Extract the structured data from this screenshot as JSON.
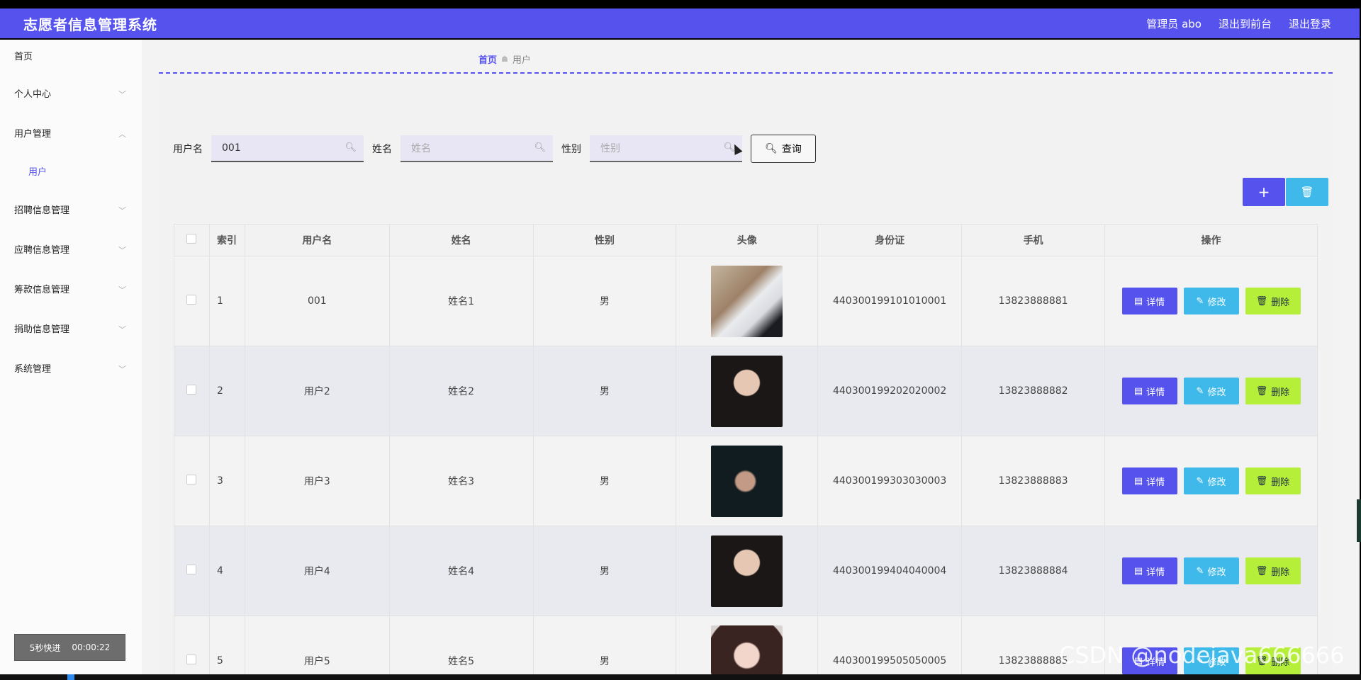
{
  "header": {
    "title": "志愿者信息管理系统",
    "admin": "管理员 abo",
    "front": "退出到前台",
    "logout": "退出登录"
  },
  "sidebar": {
    "items": [
      {
        "label": "首页"
      },
      {
        "label": "个人中心"
      },
      {
        "label": "用户管理"
      },
      {
        "label": "用户"
      },
      {
        "label": "招聘信息管理"
      },
      {
        "label": "应聘信息管理"
      },
      {
        "label": "筹款信息管理"
      },
      {
        "label": "捐助信息管理"
      },
      {
        "label": "系统管理"
      }
    ]
  },
  "timer": {
    "label": "5秒快进",
    "time": "00:00:22"
  },
  "breadcrumb": {
    "home": "首页",
    "current": "用户"
  },
  "search": {
    "username_label": "用户名",
    "username_value": "001",
    "name_label": "姓名",
    "name_placeholder": "姓名",
    "gender_label": "性别",
    "gender_placeholder": "性别",
    "query_label": "查询"
  },
  "toolbar": {
    "add": "+",
    "delete": "🗑"
  },
  "table": {
    "headers": [
      "索引",
      "用户名",
      "姓名",
      "性别",
      "头像",
      "身份证",
      "手机",
      "操作"
    ],
    "rows": [
      {
        "idx": "1",
        "user": "001",
        "name": "姓名1",
        "gender": "男",
        "id": "440300199101010001",
        "phone": "13823888881"
      },
      {
        "idx": "2",
        "user": "用户2",
        "name": "姓名2",
        "gender": "男",
        "id": "440300199202020002",
        "phone": "13823888882"
      },
      {
        "idx": "3",
        "user": "用户3",
        "name": "姓名3",
        "gender": "男",
        "id": "440300199303030003",
        "phone": "13823888883"
      },
      {
        "idx": "4",
        "user": "用户4",
        "name": "姓名4",
        "gender": "男",
        "id": "440300199404040004",
        "phone": "13823888884"
      },
      {
        "idx": "5",
        "user": "用户5",
        "name": "姓名5",
        "gender": "男",
        "id": "440300199505050005",
        "phone": "13823888885"
      }
    ],
    "op_detail": "详情",
    "op_edit": "修改",
    "op_delete": "删除"
  },
  "watermark": "CSDN @nodejava666666",
  "colors": {
    "primary": "#5552ee",
    "info": "#3fb9e9",
    "lime": "#b5ef3a"
  }
}
